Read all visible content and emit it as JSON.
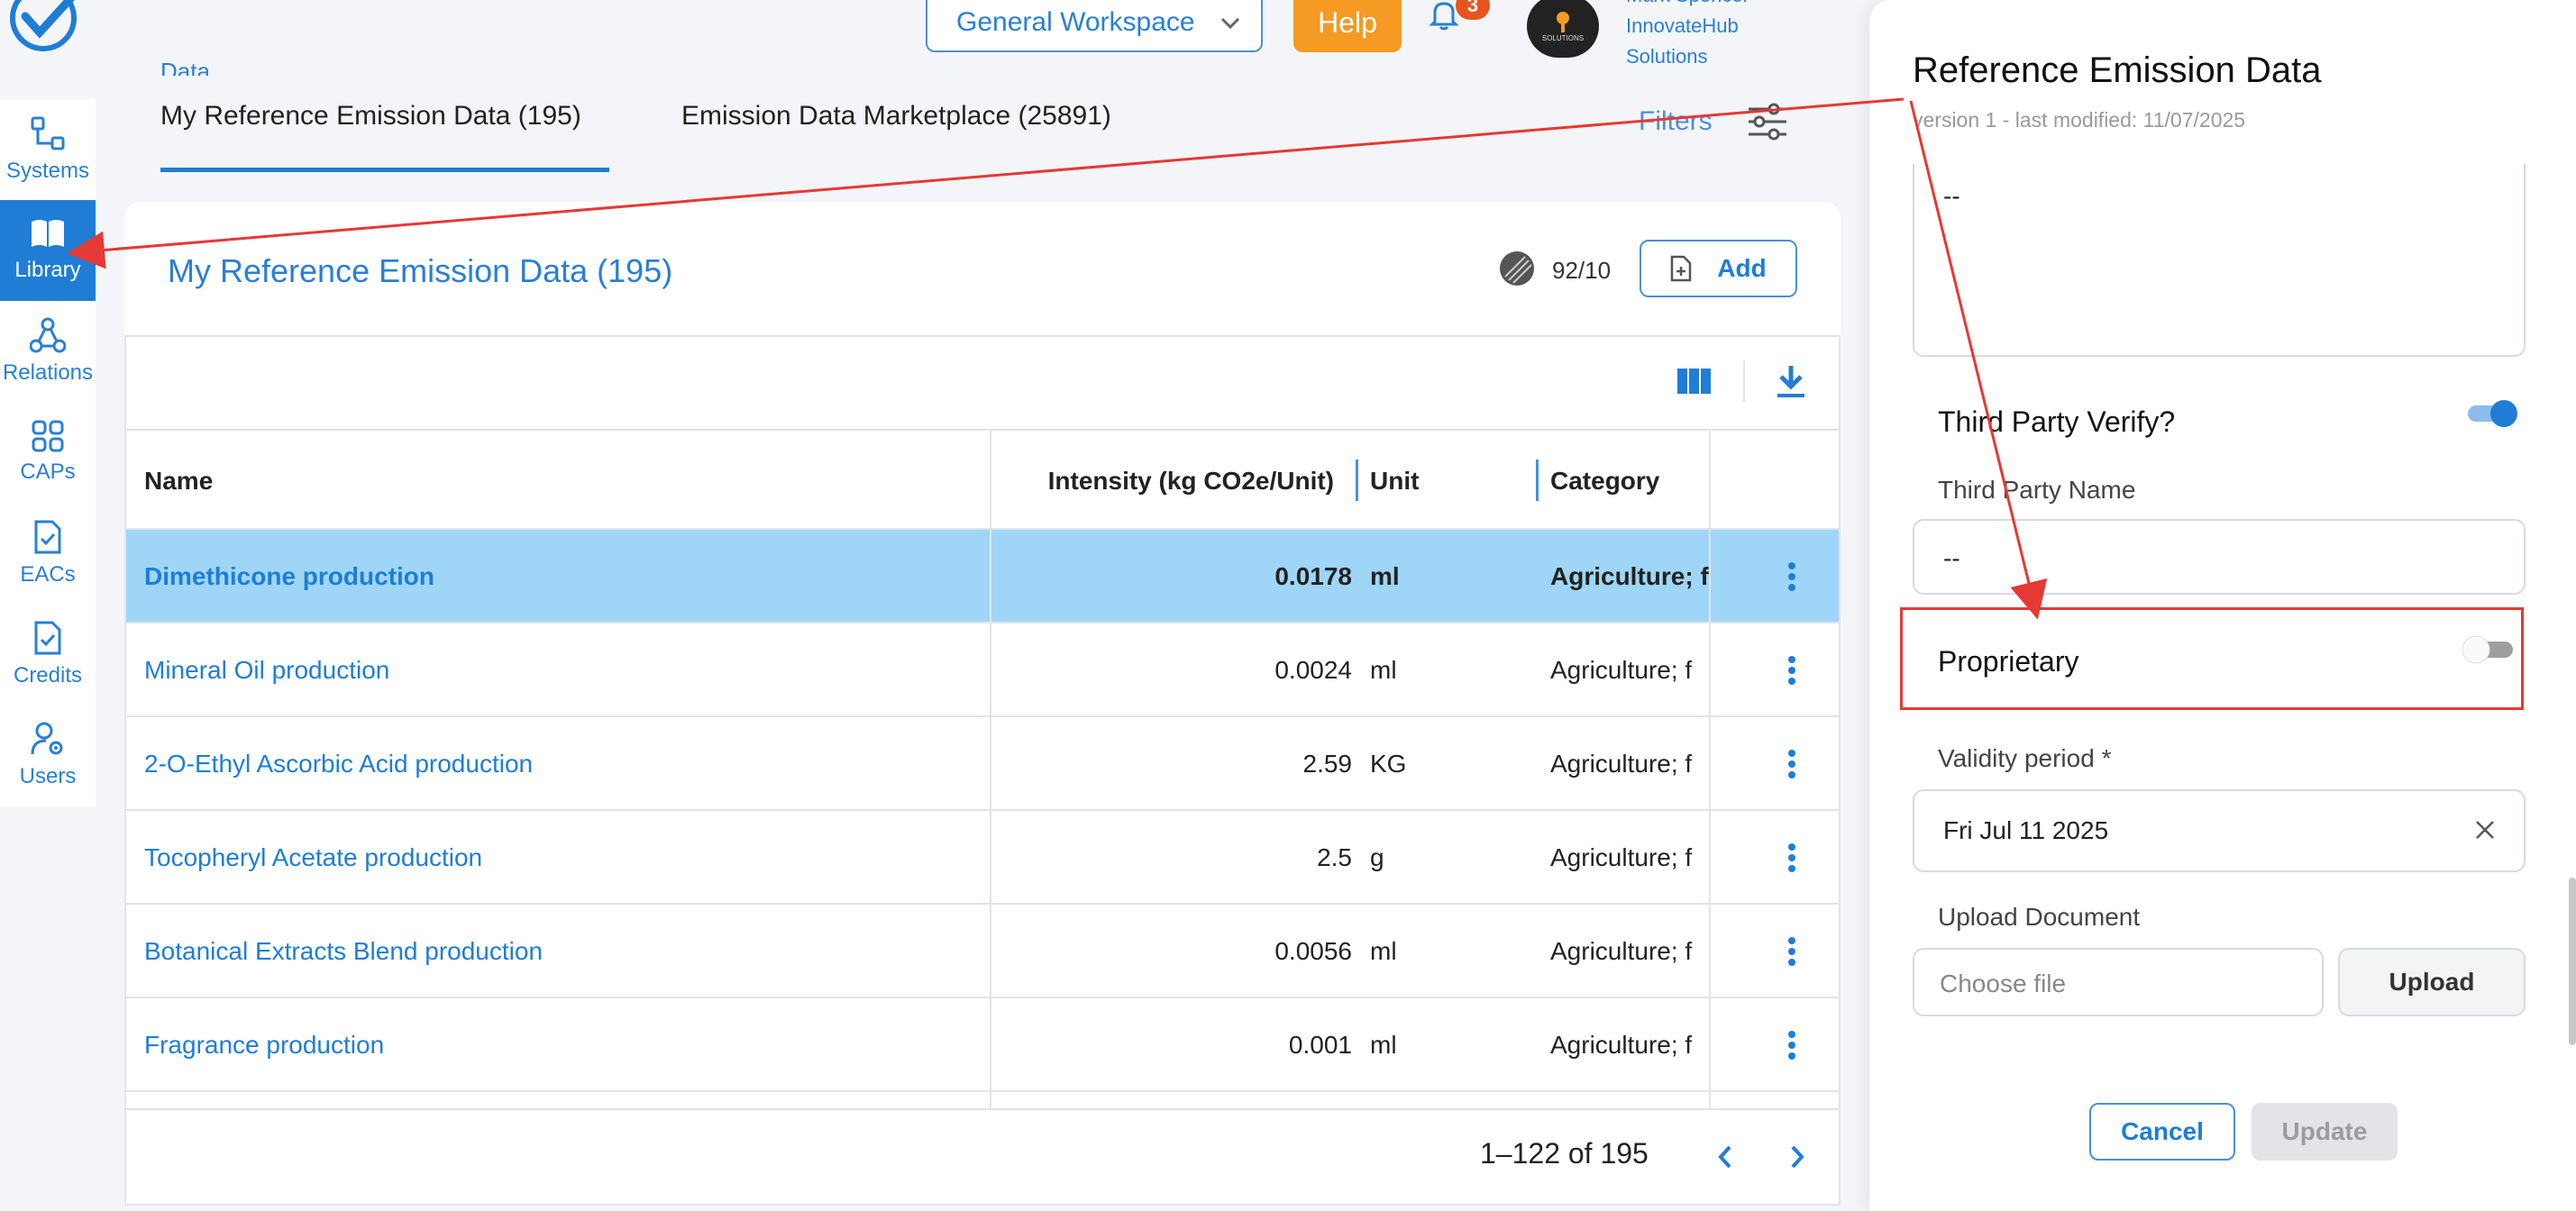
{
  "header": {
    "top_cut_label": "Data",
    "workspace": "General Workspace",
    "help_label": "Help",
    "notification_count": "3",
    "avatar_text": "SOLUTIONS",
    "user_name": "Mark Spencer",
    "org_line1": "InnovateHub",
    "org_line2": "Solutions"
  },
  "sidebar": {
    "items": [
      {
        "label": "Systems",
        "icon": "systems-icon"
      },
      {
        "label": "Library",
        "icon": "book-icon",
        "active": true
      },
      {
        "label": "Relations",
        "icon": "relations-icon"
      },
      {
        "label": "CAPs",
        "icon": "grid-icon"
      },
      {
        "label": "EACs",
        "icon": "document-check-icon"
      },
      {
        "label": "Credits",
        "icon": "document-check-icon"
      },
      {
        "label": "Users",
        "icon": "user-gear-icon"
      }
    ]
  },
  "tabs": [
    {
      "label": "My Reference Emission Data (195)",
      "active": true
    },
    {
      "label": "Emission Data Marketplace (25891)",
      "active": false
    }
  ],
  "filters_label": "Filters",
  "card": {
    "title": "My Reference Emission Data (195)",
    "counter": "92/10",
    "add_label": "Add"
  },
  "table": {
    "columns": [
      "Name",
      "Intensity (kg CO2e/Unit)",
      "Unit",
      "Category"
    ],
    "rows": [
      {
        "name": "Dimethicone production",
        "intensity": "0.0178",
        "unit": "ml",
        "category": "Agriculture; f",
        "selected": true
      },
      {
        "name": "Mineral Oil production",
        "intensity": "0.0024",
        "unit": "ml",
        "category": "Agriculture; f"
      },
      {
        "name": "2-O-Ethyl Ascorbic Acid production",
        "intensity": "2.59",
        "unit": "KG",
        "category": "Agriculture; f"
      },
      {
        "name": "Tocopheryl Acetate production",
        "intensity": "2.5",
        "unit": "g",
        "category": "Agriculture; f"
      },
      {
        "name": "Botanical Extracts Blend production",
        "intensity": "0.0056",
        "unit": "ml",
        "category": "Agriculture; f"
      },
      {
        "name": "Fragrance production",
        "intensity": "0.001",
        "unit": "ml",
        "category": "Agriculture; f"
      }
    ],
    "pagination": "1–122 of 195"
  },
  "drawer": {
    "title": "Reference Emission Data",
    "subtitle": "version 1 - last modified: 11/07/2025",
    "description_value": "--",
    "third_party_verify_label": "Third Party Verify?",
    "third_party_verify_on": true,
    "third_party_name_label": "Third Party Name",
    "third_party_name_value": "--",
    "proprietary_label": "Proprietary",
    "proprietary_on": false,
    "validity_label": "Validity period *",
    "validity_value": "Fri Jul 11 2025",
    "upload_doc_label": "Upload Document",
    "choose_file_placeholder": "Choose file",
    "upload_label": "Upload",
    "cancel_label": "Cancel",
    "update_label": "Update"
  },
  "colors": {
    "accent": "#1f7dd6",
    "selected_row": "#9fd6f7",
    "help": "#f59a23",
    "badge": "#e8541e",
    "annotation": "#e53935"
  }
}
